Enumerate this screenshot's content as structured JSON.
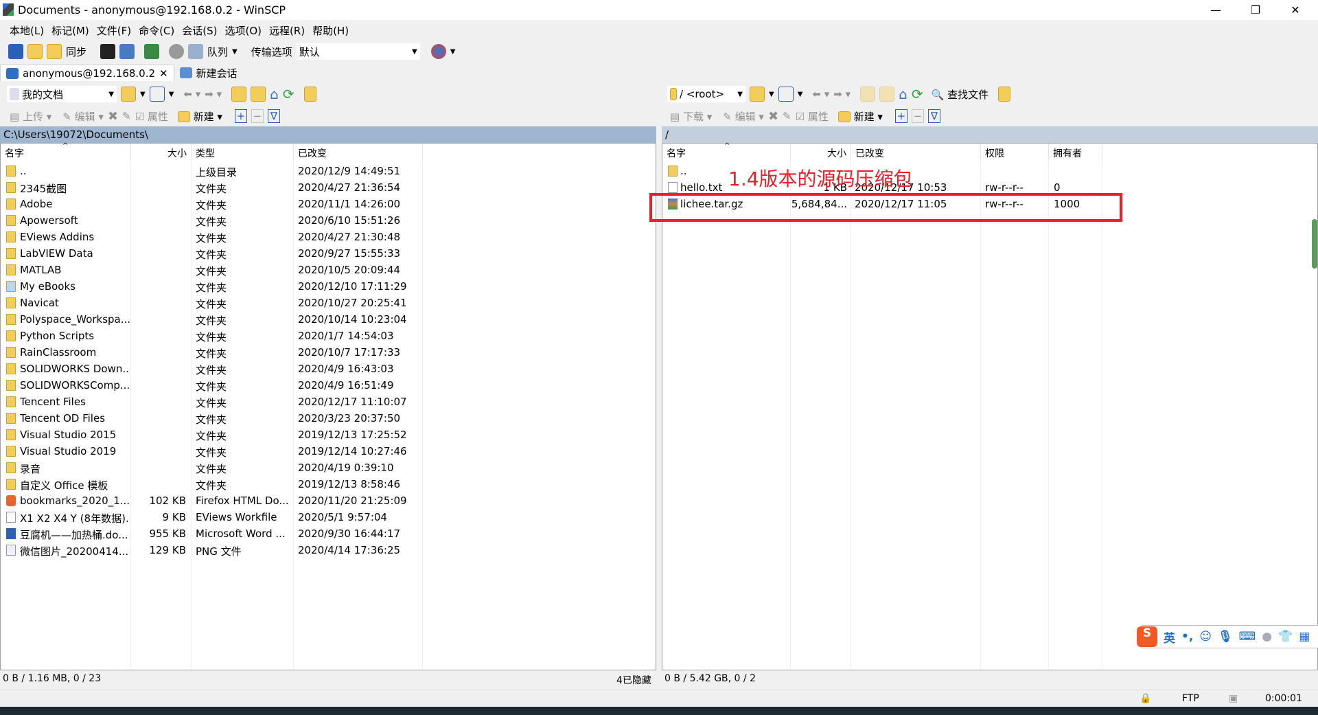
{
  "window": {
    "title": "Documents - anonymous@192.168.0.2 - WinSCP"
  },
  "menu": [
    "本地(L)",
    "标记(M)",
    "文件(F)",
    "命令(C)",
    "会话(S)",
    "选项(O)",
    "远程(R)",
    "帮助(H)"
  ],
  "toolbar": {
    "sync": "同步",
    "queue": "队列",
    "transfer_label": "传输选项",
    "transfer_value": "默认"
  },
  "tabs": [
    {
      "label": "anonymous@192.168.0.2"
    },
    {
      "label": "新建会话"
    }
  ],
  "left": {
    "location": "我的文档",
    "upload": "上传",
    "edit": "编辑",
    "props": "属性",
    "new": "新建",
    "path": "C:\\Users\\19072\\Documents\\",
    "columns": [
      "名字",
      "大小",
      "类型",
      "已改变"
    ],
    "rows": [
      {
        "name": "..",
        "size": "",
        "type": "上级目录",
        "changed": "2020/12/9  14:49:51",
        "icon": "parent"
      },
      {
        "name": "2345截图",
        "size": "",
        "type": "文件夹",
        "changed": "2020/4/27  21:36:54",
        "icon": "folder"
      },
      {
        "name": "Adobe",
        "size": "",
        "type": "文件夹",
        "changed": "2020/11/1  14:26:00",
        "icon": "folder"
      },
      {
        "name": "Apowersoft",
        "size": "",
        "type": "文件夹",
        "changed": "2020/6/10  15:51:26",
        "icon": "folder"
      },
      {
        "name": "EViews Addins",
        "size": "",
        "type": "文件夹",
        "changed": "2020/4/27  21:30:48",
        "icon": "folder"
      },
      {
        "name": "LabVIEW Data",
        "size": "",
        "type": "文件夹",
        "changed": "2020/9/27  15:55:33",
        "icon": "folder"
      },
      {
        "name": "MATLAB",
        "size": "",
        "type": "文件夹",
        "changed": "2020/10/5  20:09:44",
        "icon": "folder"
      },
      {
        "name": "My eBooks",
        "size": "",
        "type": "文件夹",
        "changed": "2020/12/10  17:11:29",
        "icon": "ebooks"
      },
      {
        "name": "Navicat",
        "size": "",
        "type": "文件夹",
        "changed": "2020/10/27  20:25:41",
        "icon": "folder"
      },
      {
        "name": "Polyspace_Workspa...",
        "size": "",
        "type": "文件夹",
        "changed": "2020/10/14  10:23:04",
        "icon": "folder"
      },
      {
        "name": "Python Scripts",
        "size": "",
        "type": "文件夹",
        "changed": "2020/1/7  14:54:03",
        "icon": "folder"
      },
      {
        "name": "RainClassroom",
        "size": "",
        "type": "文件夹",
        "changed": "2020/10/7  17:17:33",
        "icon": "folder"
      },
      {
        "name": "SOLIDWORKS Down...",
        "size": "",
        "type": "文件夹",
        "changed": "2020/4/9  16:43:03",
        "icon": "folder"
      },
      {
        "name": "SOLIDWORKSComp...",
        "size": "",
        "type": "文件夹",
        "changed": "2020/4/9  16:51:49",
        "icon": "folder"
      },
      {
        "name": "Tencent Files",
        "size": "",
        "type": "文件夹",
        "changed": "2020/12/17  11:10:07",
        "icon": "folder"
      },
      {
        "name": "Tencent OD Files",
        "size": "",
        "type": "文件夹",
        "changed": "2020/3/23  20:37:50",
        "icon": "folder"
      },
      {
        "name": "Visual Studio 2015",
        "size": "",
        "type": "文件夹",
        "changed": "2019/12/13  17:25:52",
        "icon": "folder"
      },
      {
        "name": "Visual Studio 2019",
        "size": "",
        "type": "文件夹",
        "changed": "2019/12/14  10:27:46",
        "icon": "folder"
      },
      {
        "name": "录音",
        "size": "",
        "type": "文件夹",
        "changed": "2020/4/19  0:39:10",
        "icon": "folder"
      },
      {
        "name": "自定义 Office 模板",
        "size": "",
        "type": "文件夹",
        "changed": "2019/12/13  8:58:46",
        "icon": "folder"
      },
      {
        "name": "bookmarks_2020_1...",
        "size": "102 KB",
        "type": "Firefox HTML Do...",
        "changed": "2020/11/20  21:25:09",
        "icon": "firefox"
      },
      {
        "name": "X1 X2 X4 Y (8年数据)...",
        "size": "9 KB",
        "type": "EViews Workfile",
        "changed": "2020/5/1  9:57:04",
        "icon": "file"
      },
      {
        "name": "豆腐机——加热桶.do...",
        "size": "955 KB",
        "type": "Microsoft Word ...",
        "changed": "2020/9/30  16:44:17",
        "icon": "word"
      },
      {
        "name": "微信图片_20200414...",
        "size": "129 KB",
        "type": "PNG 文件",
        "changed": "2020/4/14  17:36:25",
        "icon": "image"
      }
    ],
    "status": "0 B / 1.16 MB,  0 / 23",
    "hidden": "4已隐藏"
  },
  "right": {
    "location": "/ <root>",
    "find": "查找文件",
    "download": "下载",
    "edit": "编辑",
    "props": "属性",
    "new": "新建",
    "path": "/",
    "columns": [
      "名字",
      "大小",
      "已改变",
      "权限",
      "拥有者"
    ],
    "rows": [
      {
        "name": "..",
        "size": "",
        "changed": "",
        "perms": "",
        "owner": "",
        "icon": "parent"
      },
      {
        "name": "hello.txt",
        "size": "1 KB",
        "changed": "2020/12/17 10:53",
        "perms": "rw-r--r--",
        "owner": "0",
        "icon": "file"
      },
      {
        "name": "lichee.tar.gz",
        "size": "5,684,84...",
        "changed": "2020/12/17 11:05",
        "perms": "rw-r--r--",
        "owner": "1000",
        "icon": "archive"
      }
    ],
    "annotation": "1.4版本的源码压缩包",
    "status": "0 B / 5.42 GB,  0 / 2"
  },
  "bottom": {
    "protocol": "FTP",
    "elapsed": "0:00:01"
  },
  "ime": {
    "lang": "英",
    "punct": "•,"
  },
  "colors": {
    "pathbar": "#9fb6d1",
    "annotation": "#e8202a"
  }
}
